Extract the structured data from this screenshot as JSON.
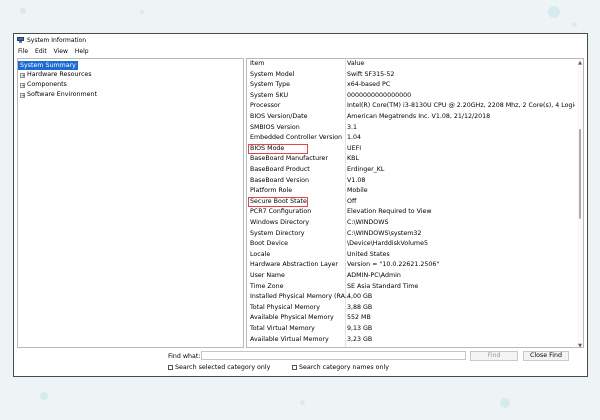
{
  "window": {
    "title": "System Information"
  },
  "menu": [
    "File",
    "Edit",
    "View",
    "Help"
  ],
  "tree": [
    {
      "label": "System Summary",
      "expander": "",
      "selected": true
    },
    {
      "label": "Hardware Resources",
      "expander": "+",
      "selected": false
    },
    {
      "label": "Components",
      "expander": "+",
      "selected": false
    },
    {
      "label": "Software Environment",
      "expander": "+",
      "selected": false
    }
  ],
  "table": {
    "headers": [
      "Item",
      "Value"
    ],
    "rows": [
      [
        "System Model",
        "Swift SF315-52"
      ],
      [
        "System Type",
        "x64-based PC"
      ],
      [
        "System SKU",
        "0000000000000000"
      ],
      [
        "Processor",
        "Intel(R) Core(TM) i3-8130U CPU @ 2.20GHz, 2208 Mhz, 2 Core(s), 4 Logical ..."
      ],
      [
        "BIOS Version/Date",
        "American Megatrends Inc. V1.08, 21/12/2018"
      ],
      [
        "SMBIOS Version",
        "3.1"
      ],
      [
        "Embedded Controller Version",
        "1.04"
      ],
      [
        "BIOS Mode",
        "UEFI"
      ],
      [
        "BaseBoard Manufacturer",
        "KBL"
      ],
      [
        "BaseBoard Product",
        "Erdinger_KL"
      ],
      [
        "BaseBoard Version",
        "V1.08"
      ],
      [
        "Platform Role",
        "Mobile"
      ],
      [
        "Secure Boot State",
        "Off"
      ],
      [
        "PCR7 Configuration",
        "Elevation Required to View"
      ],
      [
        "Windows Directory",
        "C:\\WINDOWS"
      ],
      [
        "System Directory",
        "C:\\WINDOWS\\system32"
      ],
      [
        "Boot Device",
        "\\Device\\HarddiskVolume5"
      ],
      [
        "Locale",
        "United States"
      ],
      [
        "Hardware Abstraction Layer",
        "Version = \"10.0.22621.2506\""
      ],
      [
        "User Name",
        "ADMIN-PC\\Admin"
      ],
      [
        "Time Zone",
        "SE Asia Standard Time"
      ],
      [
        "Installed Physical Memory (RA...",
        "4,00 GB"
      ],
      [
        "Total Physical Memory",
        "3,88 GB"
      ],
      [
        "Available Physical Memory",
        "552 MB"
      ],
      [
        "Total Virtual Memory",
        "9,13 GB"
      ],
      [
        "Available Virtual Memory",
        "3,23 GB"
      ]
    ],
    "highlighted": [
      "BIOS Mode",
      "Secure Boot State"
    ]
  },
  "find": {
    "label": "Find what:",
    "value": "",
    "find_button": "Find",
    "close_button": "Close Find",
    "check_selected": "Search selected category only",
    "check_names": "Search category names only"
  },
  "colors": {
    "accent": "#1c6cd3",
    "highlight_border": "#e0474c"
  },
  "icons": [
    "system-information-icon",
    "expand-plus-icon"
  ]
}
